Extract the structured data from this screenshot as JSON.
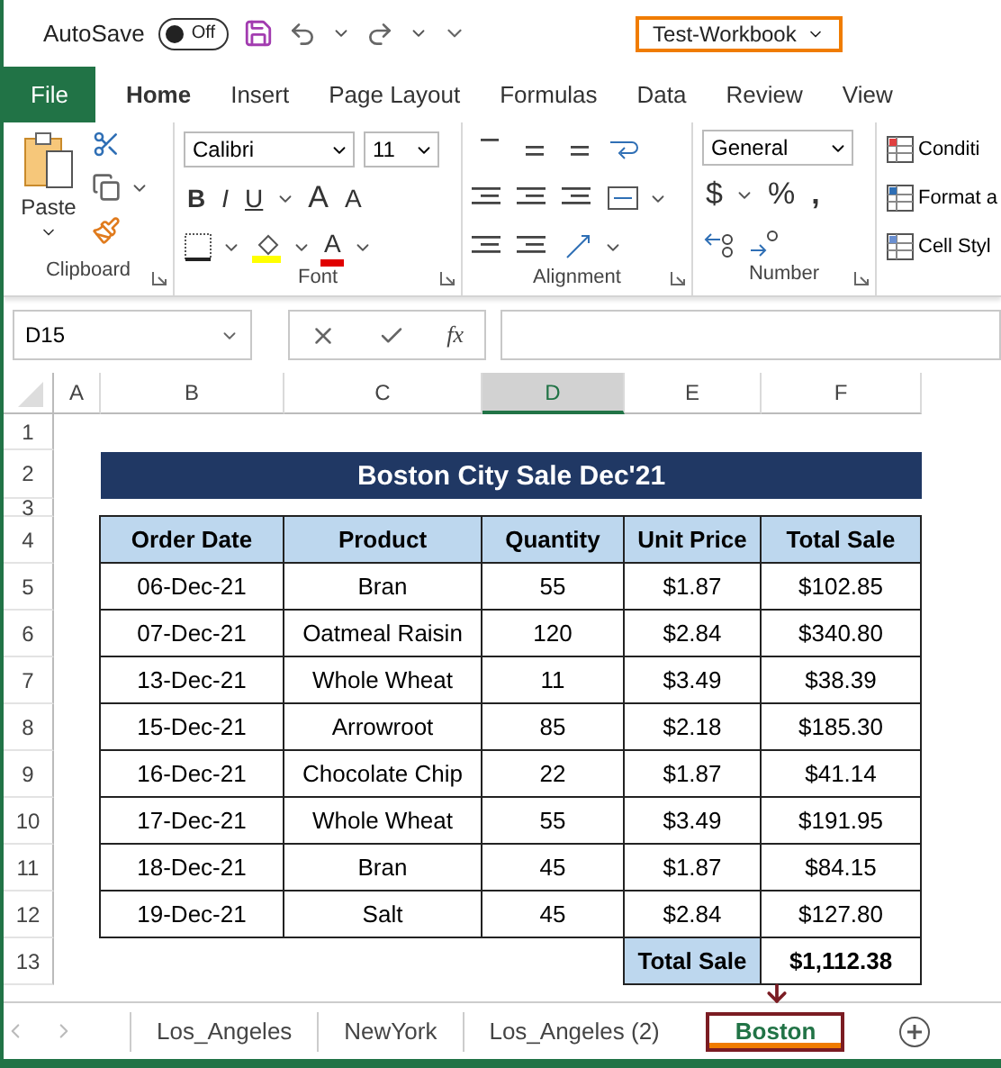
{
  "title_bar": {
    "autosave_label": "AutoSave",
    "autosave_toggle": {
      "label": "Off",
      "on": false
    },
    "workbook_name": "Test-Workbook"
  },
  "ribbon_tabs": [
    {
      "label": "File",
      "kind": "file",
      "selected": false
    },
    {
      "label": "Home",
      "kind": "tab",
      "selected": true
    },
    {
      "label": "Insert",
      "kind": "tab",
      "selected": false
    },
    {
      "label": "Page Layout",
      "kind": "tab",
      "selected": false
    },
    {
      "label": "Formulas",
      "kind": "tab",
      "selected": false
    },
    {
      "label": "Data",
      "kind": "tab",
      "selected": false
    },
    {
      "label": "Review",
      "kind": "tab",
      "selected": false
    },
    {
      "label": "View",
      "kind": "tab",
      "selected": false
    }
  ],
  "ribbon": {
    "clipboard": {
      "paste": "Paste",
      "label": "Clipboard"
    },
    "font": {
      "font_name": "Calibri",
      "font_size": "11",
      "bold": "B",
      "italic": "I",
      "underline": "U",
      "grow": "A",
      "shrink": "A",
      "font_color": "A",
      "label": "Font"
    },
    "alignment": {
      "label": "Alignment"
    },
    "number": {
      "format": "General",
      "currency": "$",
      "percent": "%",
      "comma": ",",
      "label": "Number"
    },
    "styles": {
      "items": [
        "Conditi",
        "Format a",
        "Cell Styl"
      ]
    }
  },
  "formula_bar": {
    "name_box": "D15",
    "function_label": "fx"
  },
  "columns": [
    {
      "label": "A",
      "selected": false
    },
    {
      "label": "B",
      "selected": false
    },
    {
      "label": "C",
      "selected": false
    },
    {
      "label": "D",
      "selected": true
    },
    {
      "label": "E",
      "selected": false
    },
    {
      "label": "F",
      "selected": false
    }
  ],
  "row_numbers": [
    "1",
    "2",
    "3",
    "4",
    "5",
    "6",
    "7",
    "8",
    "9",
    "10",
    "11",
    "12",
    "13"
  ],
  "table": {
    "title": "Boston City Sale Dec'21",
    "headers": [
      "Order Date",
      "Product",
      "Quantity",
      "Unit Price",
      "Total Sale"
    ],
    "rows": [
      [
        "06-Dec-21",
        "Bran",
        "55",
        "$1.87",
        "$102.85"
      ],
      [
        "07-Dec-21",
        "Oatmeal Raisin",
        "120",
        "$2.84",
        "$340.80"
      ],
      [
        "13-Dec-21",
        "Whole Wheat",
        "11",
        "$3.49",
        "$38.39"
      ],
      [
        "15-Dec-21",
        "Arrowroot",
        "85",
        "$2.18",
        "$185.30"
      ],
      [
        "16-Dec-21",
        "Chocolate Chip",
        "22",
        "$1.87",
        "$41.14"
      ],
      [
        "17-Dec-21",
        "Whole Wheat",
        "55",
        "$3.49",
        "$191.95"
      ],
      [
        "18-Dec-21",
        "Bran",
        "45",
        "$1.87",
        "$84.15"
      ],
      [
        "19-Dec-21",
        "Salt",
        "45",
        "$2.84",
        "$127.80"
      ]
    ],
    "total_label": "Total Sale",
    "total_value": "$1,112.38"
  },
  "sheet_tabs": [
    {
      "label": "Los_Angeles",
      "selected": false
    },
    {
      "label": "NewYork",
      "selected": false
    },
    {
      "label": "Los_Angeles (2)",
      "selected": false
    },
    {
      "label": "Boston",
      "selected": true
    }
  ]
}
